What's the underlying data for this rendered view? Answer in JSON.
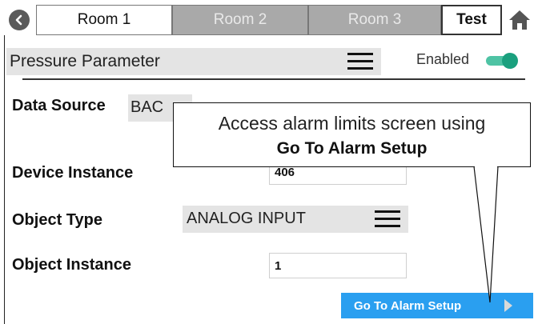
{
  "tabs": [
    {
      "label": "Room 1",
      "state": "active"
    },
    {
      "label": "Room 2",
      "state": "inactive"
    },
    {
      "label": "Room 3",
      "state": "inactive"
    },
    {
      "label": "Test",
      "state": "active"
    }
  ],
  "parameter": {
    "title": "Pressure Parameter",
    "enabled_label": "Enabled",
    "enabled": true
  },
  "fields": {
    "data_source": {
      "label": "Data Source",
      "value": "BAC"
    },
    "device_instance": {
      "label": "Device Instance",
      "value": "406"
    },
    "object_type": {
      "label": "Object Type",
      "value": "ANALOG INPUT"
    },
    "object_instance": {
      "label": "Object Instance",
      "value": "1"
    }
  },
  "action_button": {
    "label": "Go To Alarm Setup"
  },
  "callout": {
    "line1": "Access alarm limits screen using",
    "line2": "Go To Alarm Setup"
  },
  "colors": {
    "accent": "#2a9ff0",
    "toggle": "#1aa07e",
    "tab_inactive": "#a9a9a9"
  },
  "icons": [
    "back-icon",
    "home-icon",
    "menu-icon",
    "play-icon"
  ]
}
